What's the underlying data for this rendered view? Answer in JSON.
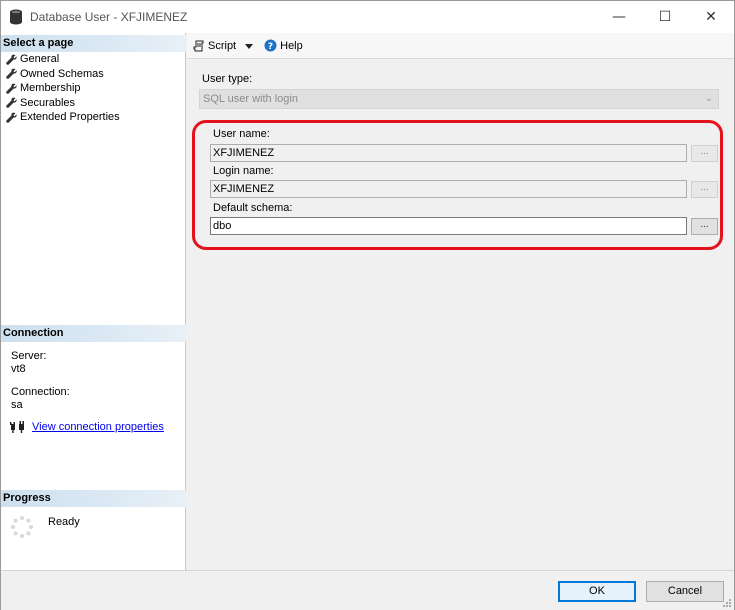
{
  "window": {
    "title": "Database User - XFJIMENEZ",
    "controls": {
      "minimize": "—",
      "maximize": "☐",
      "close": "✕"
    }
  },
  "left_pane": {
    "select_page_header": "Select a page",
    "pages": [
      {
        "label": "General"
      },
      {
        "label": "Owned Schemas"
      },
      {
        "label": "Membership"
      },
      {
        "label": "Securables"
      },
      {
        "label": "Extended Properties"
      }
    ],
    "connection_header": "Connection",
    "server_label": "Server:",
    "server_value": "vt8",
    "connection_label": "Connection:",
    "connection_value": "sa",
    "view_connection_link": "View connection properties",
    "progress_header": "Progress",
    "progress_status": "Ready"
  },
  "toolbar": {
    "script_label": "Script",
    "help_label": "Help"
  },
  "form": {
    "user_type_label": "User type:",
    "user_type_value": "SQL user with login",
    "user_name_label": "User name:",
    "user_name_value": "XFJIMENEZ",
    "login_name_label": "Login name:",
    "login_name_value": "XFJIMENEZ",
    "default_schema_label": "Default schema:",
    "default_schema_value": "dbo",
    "browse_label": "..."
  },
  "buttons": {
    "ok_label": "OK",
    "cancel_label": "Cancel"
  },
  "colors": {
    "highlight": "#e3131e",
    "link": "#0000ee",
    "default_button_border": "#0078d7",
    "section_header": "#cde0ef"
  }
}
